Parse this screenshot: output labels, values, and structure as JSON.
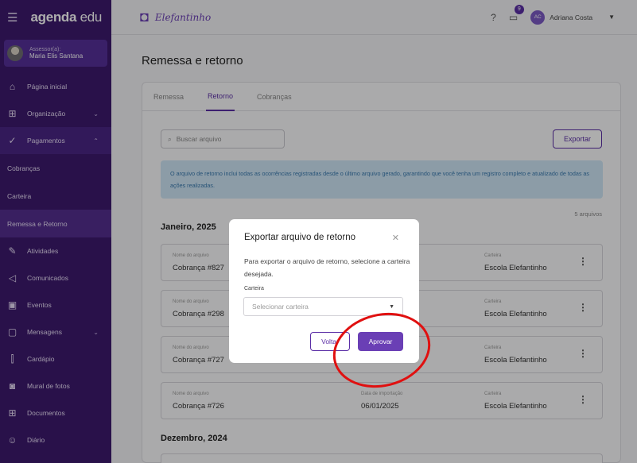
{
  "sidebar": {
    "logo": "agenda",
    "logo_suffix": "edu",
    "user_role": "Assessor(a):",
    "user_name": "Maria Elis Santana",
    "items": [
      {
        "label": "Página inicial"
      },
      {
        "label": "Organização"
      },
      {
        "label": "Pagamentos"
      },
      {
        "label": "Cobranças"
      },
      {
        "label": "Carteira"
      },
      {
        "label": "Remessa e Retorno"
      },
      {
        "label": "Atividades"
      },
      {
        "label": "Comunicados"
      },
      {
        "label": "Eventos"
      },
      {
        "label": "Mensagens"
      },
      {
        "label": "Cardápio"
      },
      {
        "label": "Mural de fotos"
      },
      {
        "label": "Documentos"
      },
      {
        "label": "Diário"
      }
    ]
  },
  "topbar": {
    "brand": "Elefantinho",
    "notification_count": "9",
    "avatar_initials": "AC",
    "user_name": "Adriana Costa"
  },
  "page": {
    "title": "Remessa e retorno",
    "tabs": [
      "Remessa",
      "Retorno",
      "Cobranças"
    ],
    "search_placeholder": "Buscar arquivo",
    "export_label": "Exportar",
    "info_text": "O arquivo de retorno inclui todas as ocorrências registradas desde o último arquivo gerado, garantindo que você tenha um registro completo e atualizado de todas as ações realizadas.",
    "file_count": "5 arquivos",
    "col_name": "Nome do arquivo",
    "col_date": "Data de importação",
    "col_wallet": "Carteira",
    "groups": [
      {
        "month": "Janeiro, 2025",
        "files": [
          {
            "name": "Cobrança #827",
            "date": "",
            "wallet": "Escola Elefantinho"
          },
          {
            "name": "Cobrança #298",
            "date": "",
            "wallet": "Escola Elefantinho"
          },
          {
            "name": "Cobrança #727",
            "date": "",
            "wallet": "Escola Elefantinho"
          },
          {
            "name": "Cobrança #726",
            "date": "06/01/2025",
            "wallet": "Escola Elefantinho"
          }
        ]
      },
      {
        "month": "Dezembro, 2024",
        "files": []
      }
    ]
  },
  "modal": {
    "title": "Exportar arquivo de retorno",
    "text": "Para exportar o arquivo de retorno, selecione a carteira desejada.",
    "select_label": "Carteira",
    "select_placeholder": "Selecionar carteira",
    "back_label": "Voltar",
    "approve_label": "Aprovar"
  },
  "colors": {
    "sidebar": "#3d1a6e",
    "accent": "#5b2ea6",
    "annotation": "#e01010"
  }
}
